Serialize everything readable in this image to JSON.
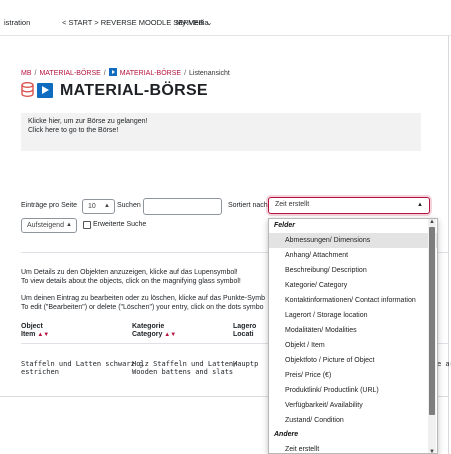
{
  "topbar": {
    "item1": "istration",
    "item2": "< START > REVERSE MOODLE SERVER ⌄",
    "item3": "My Media"
  },
  "breadcrumb": {
    "item1": "MB",
    "item2": "MATERIAL-BÖRSE",
    "item3": "MATERIAL-BÖRSE",
    "item4": "Listenansicht"
  },
  "title": "MATERIAL-BÖRSE",
  "info": {
    "line1": "Klicke hier, um zur Börse zu gelangen!",
    "line2": "Click here to go to the Börse!"
  },
  "controls": {
    "per_page_label": "Einträge pro Seite",
    "per_page_value": "10",
    "search_label": "Suchen",
    "sort_label": "Sortiert nach",
    "sort_value": "Zeit erstellt",
    "order_value": "Aufsteigend",
    "advanced_label": "Erweiterte Suche"
  },
  "paragraphs": {
    "p1_line1": "Um Details zu den Objekten anzuzeigen, klicke auf das Lupensymbol!",
    "p1_line2": "To view details about the objects, click on the magnifying glass symbol!",
    "p2_line1": "Um deinen Eintrag zu bearbeiten oder zu löschen, klicke auf das Punkte-Symb",
    "p2_line2": "To edit (\"Bearbeiten\") or delete (\"Löschen\") your entry, click on the dots symbo"
  },
  "table": {
    "headers": [
      {
        "line1": "Object",
        "line2": "Item"
      },
      {
        "line1": "Kategorie",
        "line2": "Category"
      },
      {
        "line1": "Lagero",
        "line2": "Locati"
      }
    ],
    "sort_glyph": "▲▼",
    "row1": {
      "col1_line1": "Staffeln und Latten schwarz g",
      "col1_line2": "estrichen",
      "col2_line1": "Holz Staffeln und Latten/",
      "col2_line2": "Wooden battens and slats",
      "col3": "Hauptp",
      "col4": "e ar"
    }
  },
  "dropdown": {
    "group1": "Felder",
    "options1": [
      "Abmessungen/ Dimensions",
      "Anhang/ Attachment",
      "Beschreibung/ Description",
      "Kategorie/ Category",
      "Kontaktinformationen/ Contact information",
      "Lagerort / Storage location",
      "Modalitäten/ Modalities",
      "Objekt / Item",
      "Objektfoto / Picture of Object",
      "Preis/ Price (€)",
      "Produktlink/ Productlink (URL)",
      "Verfügbarkeit/ Availability",
      "Zustand/ Condition"
    ],
    "group2": "Andere",
    "options2": [
      "Zeit erstellt"
    ]
  },
  "colors": {
    "accent": "#b5123d",
    "icon_blue": "#0f6cbf",
    "icon_red": "#d9534f",
    "highlight": "#e3e3e3"
  }
}
